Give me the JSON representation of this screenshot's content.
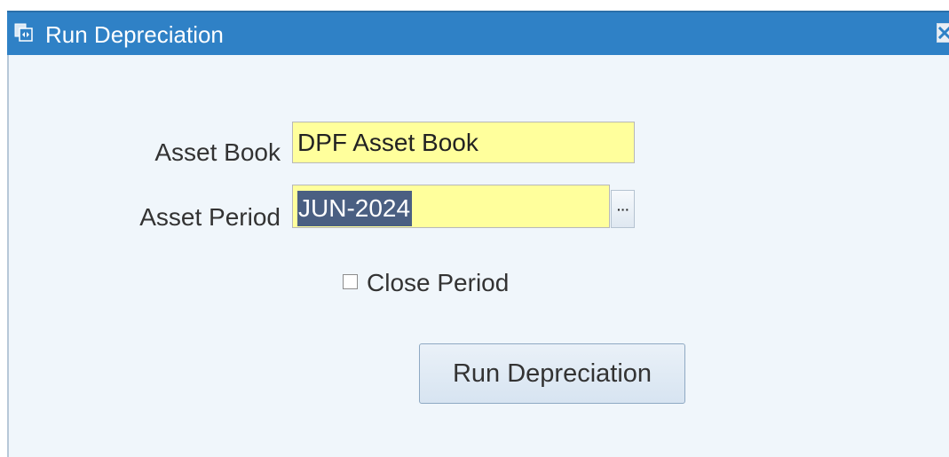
{
  "window": {
    "title": "Run Depreciation",
    "title_icon": "window-menu-icon",
    "close_icon": "close-icon"
  },
  "form": {
    "asset_book": {
      "label": "Asset Book",
      "value": "DPF Asset Book"
    },
    "asset_period": {
      "label": "Asset Period",
      "value": "JUN-2024",
      "lov_icon": "ellipsis-icon"
    },
    "close_period": {
      "label": "Close Period",
      "checked": false
    },
    "run_button_label": "Run Depreciation"
  },
  "colors": {
    "titlebar": "#2f81c6",
    "required_field": "#ffff9c",
    "selection": "#4a5f82",
    "body_background": "#f0f6fb"
  }
}
